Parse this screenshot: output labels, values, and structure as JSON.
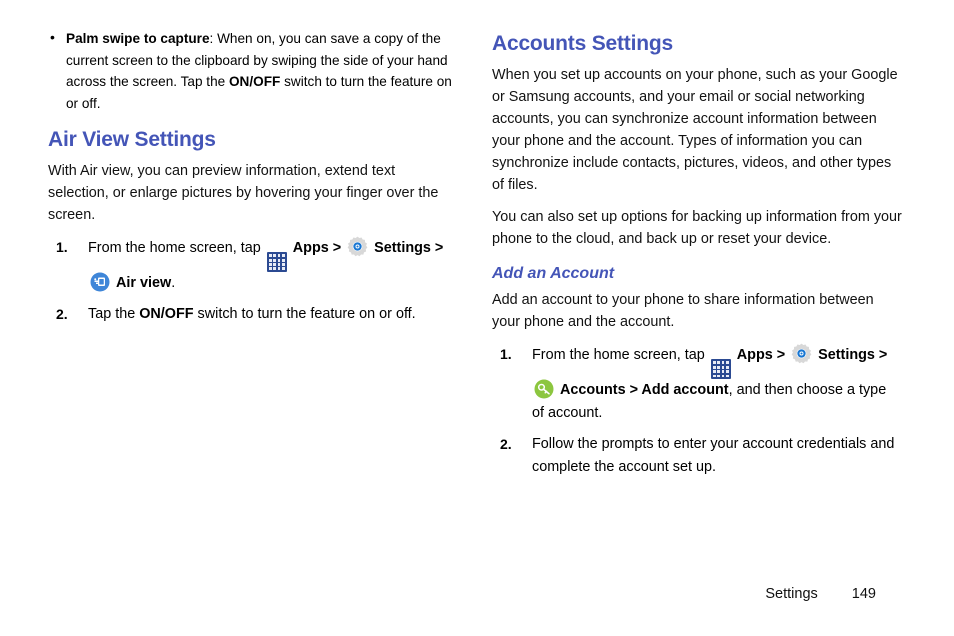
{
  "left_column": {
    "bullets": [
      {
        "term": "Palm swipe to capture",
        "separator": ": ",
        "text_before_bold": "When on, you can save a copy of the current screen to the clipboard by swiping the side of your hand across the screen. Tap the ",
        "bold_inline": "ON/OFF",
        "text_after_bold": " switch to turn the feature on or off."
      }
    ],
    "heading": "Air View Settings",
    "intro": "With Air view, you can preview information, extend text selection, or enlarge pictures by hovering your finger over the screen.",
    "steps": [
      {
        "number": "1.",
        "part1": "From the home screen, tap ",
        "apps_label": "Apps >",
        "settings_label": "Settings >",
        "airview_label": "Air view",
        "tail": "."
      },
      {
        "number": "2.",
        "part1": "Tap the ",
        "bold_inline": "ON/OFF",
        "part2": " switch to turn the feature on or off."
      }
    ]
  },
  "right_column": {
    "heading": "Accounts Settings",
    "paragraphs": [
      "When you set up accounts on your phone, such as your Google or Samsung accounts, and your email or social networking accounts, you can synchronize account information between your phone and the account. Types of information you can synchronize include contacts, pictures, videos, and other types of files.",
      "You can also set up options for backing up information from your phone to the cloud, and back up or reset your device."
    ],
    "sub_heading": "Add an Account",
    "sub_intro": "Add an account to your phone to share information between your phone and the account.",
    "steps": [
      {
        "number": "1.",
        "part1": "From the home screen, tap ",
        "apps_label": "Apps >",
        "settings_label": "Settings >",
        "accounts_label": "Accounts > Add account",
        "tail": ", and then choose a type of account."
      },
      {
        "number": "2.",
        "text": "Follow the prompts to enter your account credentials and complete the account set up."
      }
    ]
  },
  "footer": {
    "label": "Settings",
    "page_number": "149"
  },
  "icons": {
    "apps": "apps-grid-icon",
    "settings": "settings-gear-icon",
    "airview": "air-view-icon",
    "accounts": "accounts-key-icon"
  },
  "colors": {
    "heading_blue": "#4455b7",
    "apps_icon_blue": "#2b4a92",
    "settings_icon_blue": "#1876d2",
    "airview_icon_blue": "#3f86d8",
    "accounts_icon_green": "#8cc63f"
  }
}
